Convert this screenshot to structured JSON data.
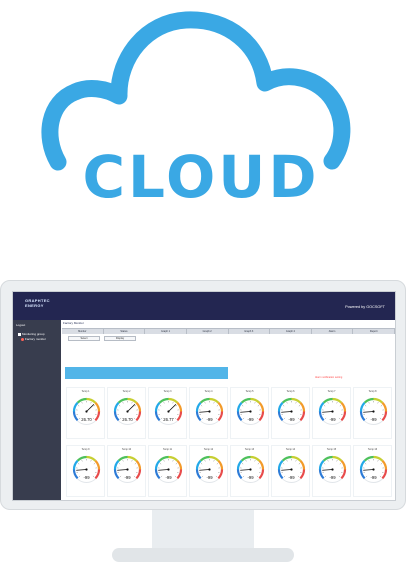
{
  "hero": {
    "title": "CLOUD",
    "color": "#3aa8e4"
  },
  "app": {
    "brand": [
      "GRAPHTEC",
      "ENERGY"
    ],
    "powered_by": "Powered by GOCSOFT",
    "sidebar": {
      "top_label": "Logout",
      "tree_root": "Monitoring group",
      "tree_child": "Factory monitor"
    },
    "group_title": "Factory Monitor",
    "tabs": [
      "Monitor",
      "Status",
      "Graph 1",
      "Graph 2",
      "Graph 3",
      "Graph 4",
      "Alarm",
      "Report"
    ],
    "actions": [
      "Select",
      "Display"
    ],
    "alert_note": "Alarm notification setting"
  },
  "gauges": [
    {
      "label": "Temp 1",
      "value": "26.70",
      "level": 0.67
    },
    {
      "label": "Temp 2",
      "value": "26.70",
      "level": 0.67
    },
    {
      "label": "Temp 3",
      "value": "26.77",
      "level": 0.67
    },
    {
      "label": "Temp 4",
      "value": "-99",
      "level": 0.15
    },
    {
      "label": "Temp 5",
      "value": "-99",
      "level": 0.15
    },
    {
      "label": "Temp 6",
      "value": "-99",
      "level": 0.15
    },
    {
      "label": "Temp 7",
      "value": "-99",
      "level": 0.15
    },
    {
      "label": "Temp 8",
      "value": "-99",
      "level": 0.15
    },
    {
      "label": "Temp 9",
      "value": "-99",
      "level": 0.15
    },
    {
      "label": "Temp 10",
      "value": "-99",
      "level": 0.15
    },
    {
      "label": "Temp 11",
      "value": "-99",
      "level": 0.15
    },
    {
      "label": "Temp 12",
      "value": "-99",
      "level": 0.15
    },
    {
      "label": "Temp 13",
      "value": "-99",
      "level": 0.15
    },
    {
      "label": "Temp 14",
      "value": "-99",
      "level": 0.15
    },
    {
      "label": "Temp 15",
      "value": "-99",
      "level": 0.15
    },
    {
      "label": "Temp 16",
      "value": "-99",
      "level": 0.15
    }
  ],
  "colors": {
    "header": "#232651",
    "sidebar": "#383d4e",
    "banner": "#52b5e8",
    "alert": "#ff4d4d"
  }
}
